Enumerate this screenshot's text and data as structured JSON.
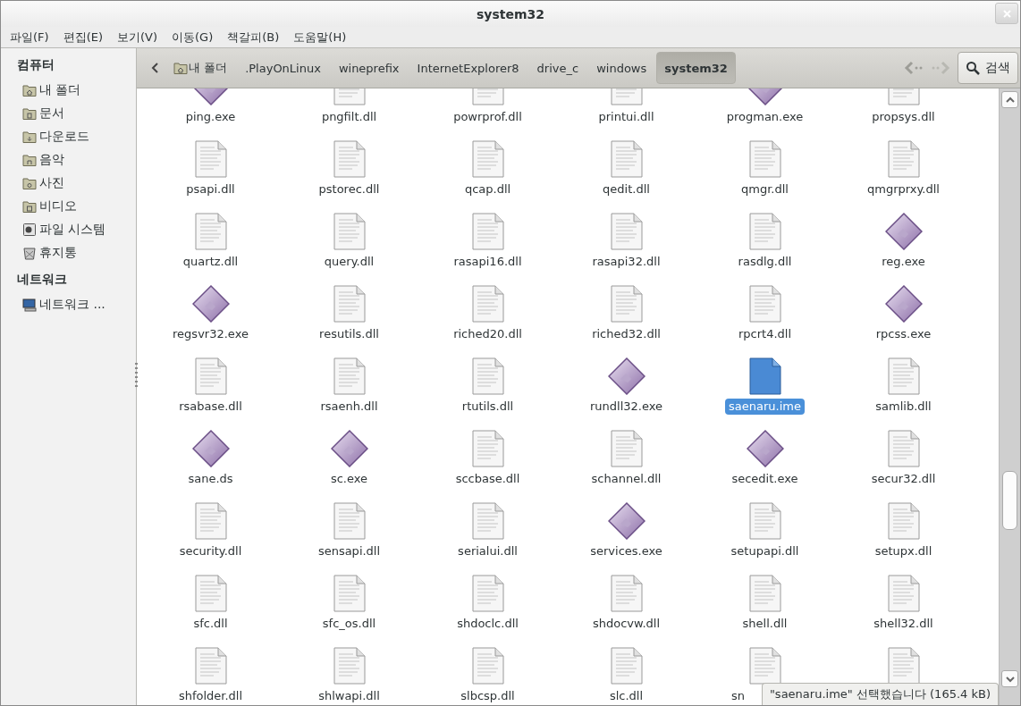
{
  "window": {
    "title": "system32"
  },
  "menu": [
    "파일(F)",
    "편집(E)",
    "보기(V)",
    "이동(G)",
    "책갈피(B)",
    "도움말(H)"
  ],
  "sidebar": {
    "sections": [
      {
        "heading": "컴퓨터",
        "items": [
          {
            "label": "내 폴더",
            "kind": "home"
          },
          {
            "label": "문서",
            "kind": "documents"
          },
          {
            "label": "다운로드",
            "kind": "downloads"
          },
          {
            "label": "음악",
            "kind": "music"
          },
          {
            "label": "사진",
            "kind": "pictures"
          },
          {
            "label": "비디오",
            "kind": "videos"
          },
          {
            "label": "파일 시스템",
            "kind": "filesystem"
          },
          {
            "label": "휴지통",
            "kind": "trash"
          }
        ]
      },
      {
        "heading": "네트워크",
        "items": [
          {
            "label": "네트워크 ...",
            "kind": "network"
          }
        ]
      }
    ]
  },
  "path_bar": {
    "crumbs": [
      {
        "label": "내 폴더",
        "kind": "home",
        "selected": false
      },
      {
        "label": ".PlayOnLinux",
        "kind": "folder",
        "selected": false
      },
      {
        "label": "wineprefix",
        "kind": "folder",
        "selected": false
      },
      {
        "label": "InternetExplorer8",
        "kind": "folder",
        "selected": false
      },
      {
        "label": "drive_c",
        "kind": "folder",
        "selected": false
      },
      {
        "label": "windows",
        "kind": "folder",
        "selected": false
      },
      {
        "label": "system32",
        "kind": "folder",
        "selected": true
      }
    ],
    "search_button": "검색"
  },
  "files": [
    {
      "name": "ping.exe",
      "kind": "exe",
      "selected": false
    },
    {
      "name": "pngfilt.dll",
      "kind": "dll",
      "selected": false
    },
    {
      "name": "powrprof.dll",
      "kind": "dll",
      "selected": false
    },
    {
      "name": "printui.dll",
      "kind": "dll",
      "selected": false
    },
    {
      "name": "progman.exe",
      "kind": "exe",
      "selected": false
    },
    {
      "name": "propsys.dll",
      "kind": "dll",
      "selected": false
    },
    {
      "name": "psapi.dll",
      "kind": "dll",
      "selected": false
    },
    {
      "name": "pstorec.dll",
      "kind": "dll",
      "selected": false
    },
    {
      "name": "qcap.dll",
      "kind": "dll",
      "selected": false
    },
    {
      "name": "qedit.dll",
      "kind": "dll",
      "selected": false
    },
    {
      "name": "qmgr.dll",
      "kind": "dll",
      "selected": false
    },
    {
      "name": "qmgrprxy.dll",
      "kind": "dll",
      "selected": false
    },
    {
      "name": "quartz.dll",
      "kind": "dll",
      "selected": false
    },
    {
      "name": "query.dll",
      "kind": "dll",
      "selected": false
    },
    {
      "name": "rasapi16.dll",
      "kind": "dll",
      "selected": false
    },
    {
      "name": "rasapi32.dll",
      "kind": "dll",
      "selected": false
    },
    {
      "name": "rasdlg.dll",
      "kind": "dll",
      "selected": false
    },
    {
      "name": "reg.exe",
      "kind": "exe",
      "selected": false
    },
    {
      "name": "regsvr32.exe",
      "kind": "exe",
      "selected": false
    },
    {
      "name": "resutils.dll",
      "kind": "dll",
      "selected": false
    },
    {
      "name": "riched20.dll",
      "kind": "dll",
      "selected": false
    },
    {
      "name": "riched32.dll",
      "kind": "dll",
      "selected": false
    },
    {
      "name": "rpcrt4.dll",
      "kind": "dll",
      "selected": false
    },
    {
      "name": "rpcss.exe",
      "kind": "exe",
      "selected": false
    },
    {
      "name": "rsabase.dll",
      "kind": "dll",
      "selected": false
    },
    {
      "name": "rsaenh.dll",
      "kind": "dll",
      "selected": false
    },
    {
      "name": "rtutils.dll",
      "kind": "dll",
      "selected": false
    },
    {
      "name": "rundll32.exe",
      "kind": "exe",
      "selected": false
    },
    {
      "name": "saenaru.ime",
      "kind": "dll",
      "selected": true
    },
    {
      "name": "samlib.dll",
      "kind": "dll",
      "selected": false
    },
    {
      "name": "sane.ds",
      "kind": "exe",
      "selected": false
    },
    {
      "name": "sc.exe",
      "kind": "exe",
      "selected": false
    },
    {
      "name": "sccbase.dll",
      "kind": "dll",
      "selected": false
    },
    {
      "name": "schannel.dll",
      "kind": "dll",
      "selected": false
    },
    {
      "name": "secedit.exe",
      "kind": "exe",
      "selected": false
    },
    {
      "name": "secur32.dll",
      "kind": "dll",
      "selected": false
    },
    {
      "name": "security.dll",
      "kind": "dll",
      "selected": false
    },
    {
      "name": "sensapi.dll",
      "kind": "dll",
      "selected": false
    },
    {
      "name": "serialui.dll",
      "kind": "dll",
      "selected": false
    },
    {
      "name": "services.exe",
      "kind": "exe",
      "selected": false
    },
    {
      "name": "setupapi.dll",
      "kind": "dll",
      "selected": false
    },
    {
      "name": "setupx.dll",
      "kind": "dll",
      "selected": false
    },
    {
      "name": "sfc.dll",
      "kind": "dll",
      "selected": false
    },
    {
      "name": "sfc_os.dll",
      "kind": "dll",
      "selected": false
    },
    {
      "name": "shdoclc.dll",
      "kind": "dll",
      "selected": false
    },
    {
      "name": "shdocvw.dll",
      "kind": "dll",
      "selected": false
    },
    {
      "name": "shell.dll",
      "kind": "dll",
      "selected": false
    },
    {
      "name": "shell32.dll",
      "kind": "dll",
      "selected": false
    },
    {
      "name": "shfolder.dll",
      "kind": "dll",
      "selected": false
    },
    {
      "name": "shlwapi.dll",
      "kind": "dll",
      "selected": false
    },
    {
      "name": "slbcsp.dll",
      "kind": "dll",
      "selected": false
    },
    {
      "name": "slc.dll",
      "kind": "dll",
      "selected": false
    },
    {
      "name": "sn",
      "kind": "dll",
      "selected": false,
      "cut": true
    },
    {
      "kind": "dll",
      "selected": false
    }
  ],
  "status": "\"saenaru.ime\" 선택했습니다 (165.4 kB)"
}
